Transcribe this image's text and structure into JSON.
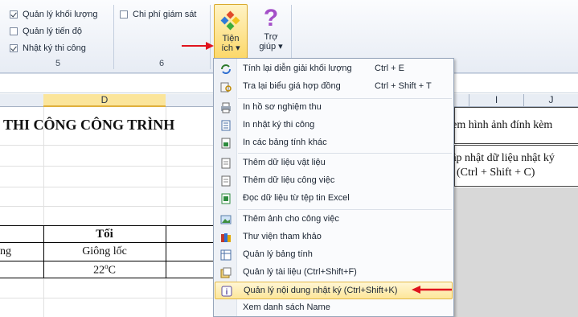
{
  "ribbon": {
    "checkboxes": [
      {
        "label": "Quản lý khối lượng",
        "checked": true
      },
      {
        "label": "Quản lý tiến độ",
        "checked": false
      },
      {
        "label": "Nhật ký thi công",
        "checked": true
      },
      {
        "label": "Chi phí giám sát",
        "checked": false
      }
    ],
    "group5_label": "5",
    "group6_label": "6",
    "tien_ich_line1": "Tiện",
    "tien_ich_line2": "ích ▾",
    "tro_giup_line1": "Trợ",
    "tro_giup_line2": "giúp ▾"
  },
  "columns": {
    "d": "D",
    "i": "I",
    "j": "J"
  },
  "sheet": {
    "title": "THI CÔNG CÔNG TRÌNH",
    "header_toi": "Tối",
    "cell_ng": "ng",
    "cell_giong_loc": "Giông lốc",
    "cell_temp_value": "22",
    "cell_temp_unit": "o",
    "cell_temp_c": "C",
    "right_cell1": "Xem hình ảnh đính kèm",
    "right_cell2_line1": "Cập nhật dữ liệu nhật ký",
    "right_cell2_line2": "(Ctrl + Shift + C)"
  },
  "menu": {
    "items": [
      {
        "label": "Tính lại diễn giải khối lượng",
        "shortcut": "Ctrl + E",
        "icon": "recalc-icon"
      },
      {
        "label": "Tra lại biểu giá hợp đồng",
        "shortcut": "Ctrl + Shift + T",
        "icon": "price-lookup-icon"
      },
      {
        "label": "In hồ sơ nghiệm thu",
        "shortcut": "",
        "icon": "print-icon"
      },
      {
        "label": "In nhật ký thi công",
        "shortcut": "",
        "icon": "print-log-icon"
      },
      {
        "label": "In các bảng tính khác",
        "shortcut": "",
        "icon": "print-sheets-icon"
      },
      {
        "label": "Thêm dữ liệu vật liệu",
        "shortcut": "",
        "icon": "add-material-icon"
      },
      {
        "label": "Thêm dữ liệu công việc",
        "shortcut": "",
        "icon": "add-task-icon"
      },
      {
        "label": "Đọc dữ liệu từ tệp tin Excel",
        "shortcut": "",
        "icon": "excel-import-icon"
      },
      {
        "label": "Thêm ảnh cho công việc",
        "shortcut": "",
        "icon": "add-image-icon"
      },
      {
        "label": "Thư viện tham khảo",
        "shortcut": "",
        "icon": "library-icon"
      },
      {
        "label": "Quản lý bảng tính",
        "shortcut": "",
        "icon": "sheet-manager-icon"
      },
      {
        "label": "Quản lý tài liệu (Ctrl+Shift+F)",
        "shortcut": "",
        "icon": "document-manager-icon"
      },
      {
        "label": "Quản lý nội dung nhật ký (Ctrl+Shift+K)",
        "shortcut": "",
        "icon": "log-content-icon"
      },
      {
        "label": "Xem danh sách Name",
        "shortcut": "",
        "icon": "names-list-icon"
      }
    ]
  },
  "colors": {
    "accent_arrow": "#e0141e",
    "highlight": "#fde69a",
    "selected_col": "#fbe59b"
  }
}
